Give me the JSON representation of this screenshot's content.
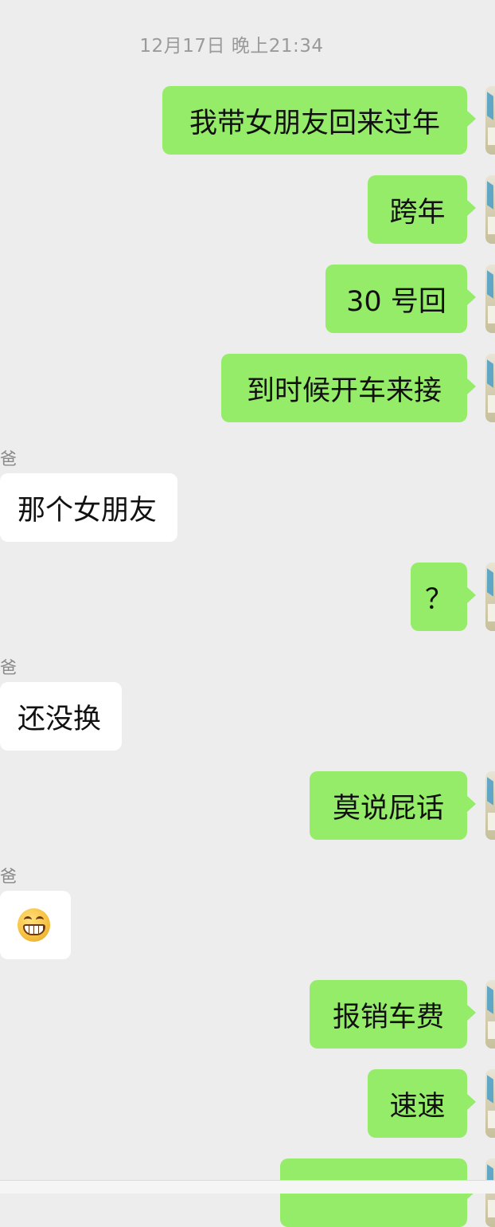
{
  "chat": {
    "timestamp": "12月17日 晚上21:34",
    "messages": [
      {
        "dir": "out",
        "text": "我带女朋友回来过年"
      },
      {
        "dir": "out",
        "text": "跨年"
      },
      {
        "dir": "out",
        "text": "30 号回"
      },
      {
        "dir": "out",
        "text": "到时候开车来接"
      },
      {
        "dir": "in",
        "sender": "爸",
        "text": "那个女朋友"
      },
      {
        "dir": "out",
        "text": "？"
      },
      {
        "dir": "in",
        "sender": "爸",
        "text": "还没换"
      },
      {
        "dir": "out",
        "text": "莫说屁话"
      },
      {
        "dir": "in",
        "sender": "爸",
        "emoji": "grinning-face-emoji"
      },
      {
        "dir": "out",
        "text": "报销车费"
      },
      {
        "dir": "out",
        "text": "速速"
      },
      {
        "dir": "out",
        "text": ""
      }
    ]
  },
  "colors": {
    "background": "#ededed",
    "outgoing_bubble": "#95ec69",
    "incoming_bubble": "#ffffff",
    "timestamp_text": "#9a9a9a"
  }
}
